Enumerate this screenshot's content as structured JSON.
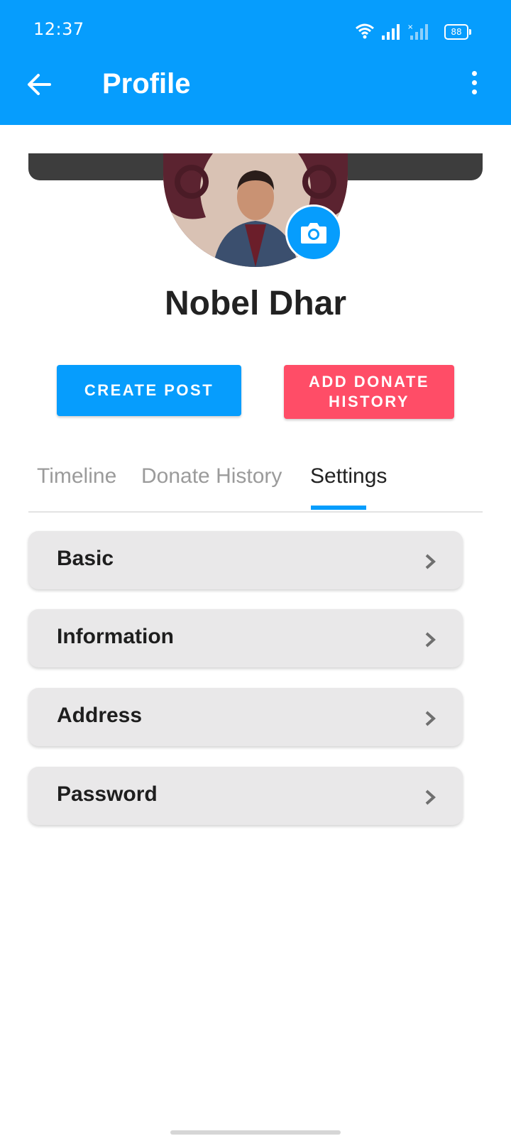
{
  "status_bar": {
    "time": "12:37",
    "battery": "88"
  },
  "app_bar": {
    "title": "Profile",
    "back_icon": "arrow-left-icon",
    "menu_icon": "more-vert-icon"
  },
  "profile": {
    "name": "Nobel Dhar"
  },
  "actions": {
    "create_post": "CREATE POST",
    "add_donate_line1": "ADD DONATE",
    "add_donate_line2": "HISTORY"
  },
  "tabs": [
    {
      "label": "Timeline"
    },
    {
      "label": "Donate History"
    },
    {
      "label": "Settings",
      "active": true
    }
  ],
  "settings": [
    {
      "label": "Basic"
    },
    {
      "label": "Information"
    },
    {
      "label": "Address"
    },
    {
      "label": "Password"
    }
  ],
  "colors": {
    "primary": "#069dfd",
    "danger": "#ff4d67"
  }
}
